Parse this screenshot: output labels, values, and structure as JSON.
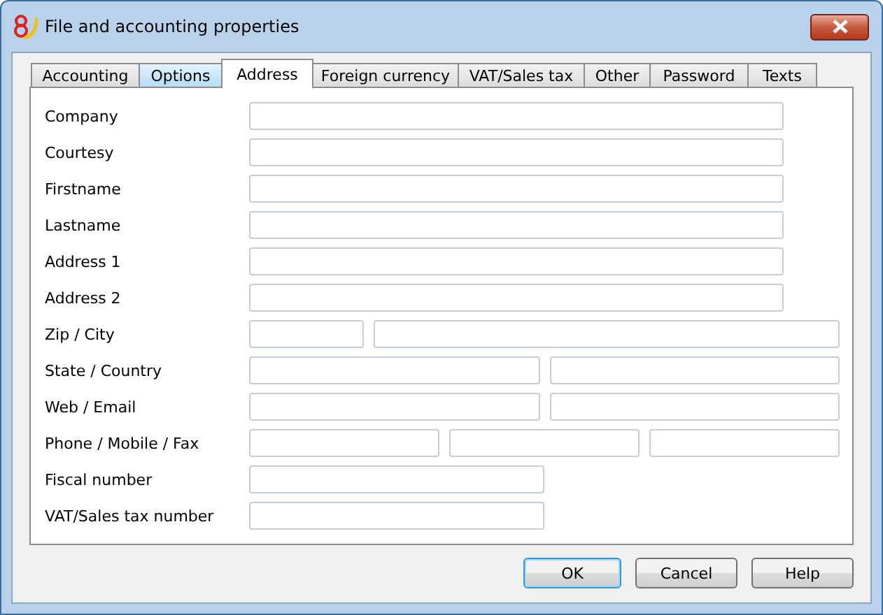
{
  "window": {
    "title": "File and accounting properties"
  },
  "tabs": [
    {
      "label": "Accounting",
      "selected": false,
      "hovered": false
    },
    {
      "label": "Options",
      "selected": false,
      "hovered": true
    },
    {
      "label": "Address",
      "selected": true,
      "hovered": false
    },
    {
      "label": "Foreign currency",
      "selected": false,
      "hovered": false
    },
    {
      "label": "VAT/Sales tax",
      "selected": false,
      "hovered": false
    },
    {
      "label": "Other",
      "selected": false,
      "hovered": false
    },
    {
      "label": "Password",
      "selected": false,
      "hovered": false
    },
    {
      "label": "Texts",
      "selected": false,
      "hovered": false
    }
  ],
  "rows": [
    {
      "label": "Company",
      "kind": "single"
    },
    {
      "label": "Courtesy",
      "kind": "single"
    },
    {
      "label": "Firstname",
      "kind": "single"
    },
    {
      "label": "Lastname",
      "kind": "single"
    },
    {
      "label": "Address 1",
      "kind": "single"
    },
    {
      "label": "Address 2",
      "kind": "single"
    },
    {
      "label": "Zip / City",
      "kind": "zip"
    },
    {
      "label": "State / Country",
      "kind": "pair"
    },
    {
      "label": "Web / Email",
      "kind": "pair"
    },
    {
      "label": "Phone / Mobile / Fax",
      "kind": "triple"
    },
    {
      "label": "Fiscal number",
      "kind": "short"
    },
    {
      "label": "VAT/Sales tax number",
      "kind": "short"
    }
  ],
  "buttons": [
    {
      "label": "OK",
      "default": true
    },
    {
      "label": "Cancel",
      "default": false
    },
    {
      "label": "Help",
      "default": false
    }
  ]
}
